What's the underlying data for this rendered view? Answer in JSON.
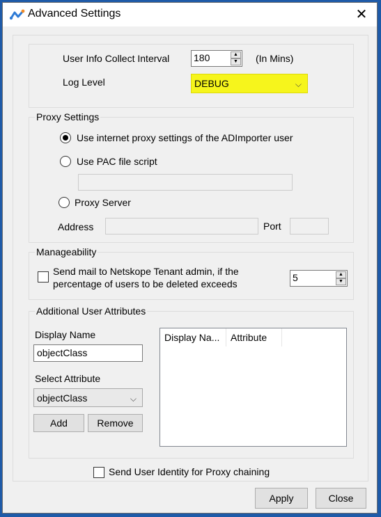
{
  "window": {
    "title": "Advanced Settings",
    "close_glyph": "✕"
  },
  "general": {
    "interval_label": "User Info Collect Interval",
    "interval_value": "180",
    "interval_unit": "(In Mins)",
    "log_level_label": "Log Level",
    "log_level_value": "DEBUG"
  },
  "proxy": {
    "title": "Proxy Settings",
    "option_system": "Use internet proxy settings of the ADImporter user",
    "option_pac": "Use PAC file script",
    "option_server": "Proxy Server",
    "address_label": "Address",
    "port_label": "Port",
    "pac_value": "",
    "address_value": "",
    "port_value": ""
  },
  "manageability": {
    "title": "Manageability",
    "mail_line1": "Send mail to Netskope Tenant admin, if the",
    "mail_line2": "percentage of users to be deleted exceeds",
    "threshold_value": "5"
  },
  "attributes": {
    "title": "Additional User Attributes",
    "display_name_label": "Display Name",
    "display_name_value": "objectClass",
    "select_attribute_label": "Select Attribute",
    "select_attribute_value": "objectClass",
    "add_label": "Add",
    "remove_label": "Remove",
    "columns": [
      "Display Na...",
      "Attribute"
    ]
  },
  "footer": {
    "proxy_chaining_label": "Send User Identity for Proxy chaining",
    "apply_label": "Apply",
    "close_label": "Close"
  },
  "colors": {
    "highlight": "#f6f51c",
    "titlebar": "#ffffff",
    "background": "#f0f0f0"
  },
  "icons": {
    "app": "netskope-logo-icon",
    "close": "close-icon",
    "dropdown": "chevron-down-icon",
    "spin": "spin-arrows-icon"
  }
}
